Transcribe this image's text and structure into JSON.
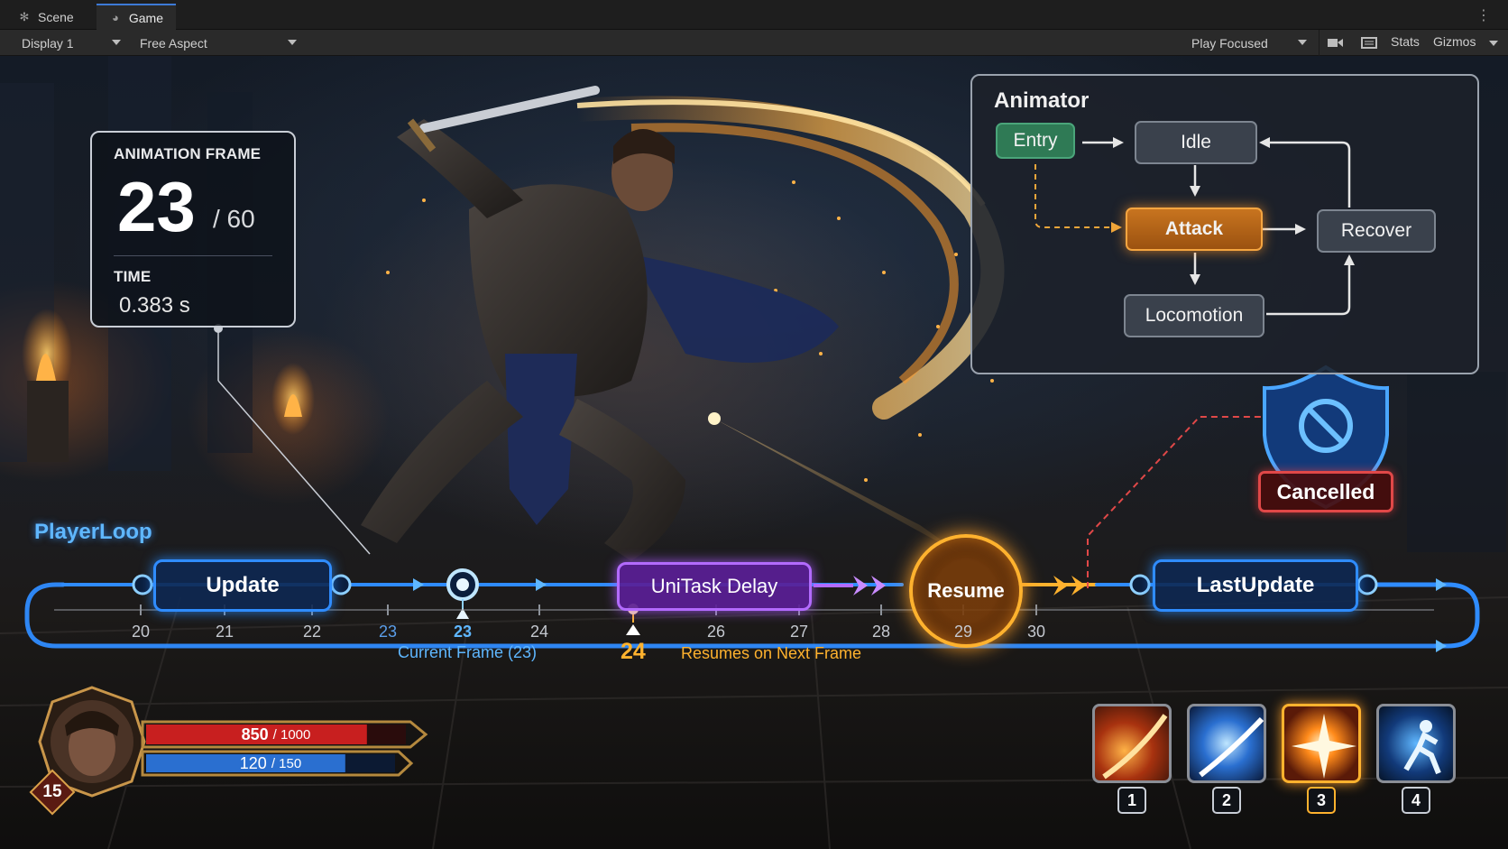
{
  "editor": {
    "tabs": [
      {
        "label": "Scene",
        "icon": "scene-icon"
      },
      {
        "label": "Game",
        "icon": "game-controller-icon"
      }
    ],
    "toolbar": {
      "display": "Display 1",
      "aspect": "Free Aspect",
      "play_mode": "Play Focused",
      "stats": "Stats",
      "gizmos": "Gizmos"
    }
  },
  "animation_frame": {
    "label": "ANIMATION FRAME",
    "frame": "23",
    "total": "/ 60",
    "time_label": "TIME",
    "time_value": "0.383 s"
  },
  "animator": {
    "title": "Animator",
    "states": {
      "entry": "Entry",
      "idle": "Idle",
      "attack": "Attack",
      "recover": "Recover",
      "locomotion": "Locomotion"
    }
  },
  "player_loop": {
    "title": "PlayerLoop",
    "update": "Update",
    "unitask_delay": "UniTask Delay",
    "resume": "Resume",
    "last_update": "LastUpdate",
    "ticks": [
      "20",
      "21",
      "22",
      "23",
      "23",
      "24",
      "26",
      "27",
      "28",
      "29",
      "30"
    ],
    "current_frame_note": "Current Frame (23)",
    "next_frame": "24",
    "next_frame_note": "Resumes on Next Frame"
  },
  "cancel": {
    "label": "Cancelled",
    "colors": {
      "shield": "#1e63c8",
      "badge_border": "#e04848"
    }
  },
  "hud": {
    "level": "15",
    "hp": {
      "value": "850",
      "max": "/ 1000",
      "fraction": 0.85
    },
    "mp": {
      "value": "120",
      "max": "/ 150",
      "fraction": 0.8
    },
    "skills": [
      {
        "key": "1",
        "icon": "fire-slash-icon",
        "active": false
      },
      {
        "key": "2",
        "icon": "ice-slash-icon",
        "active": false
      },
      {
        "key": "3",
        "icon": "burst-icon",
        "active": true
      },
      {
        "key": "4",
        "icon": "dash-icon",
        "active": false
      }
    ]
  },
  "colors": {
    "loop_blue": "#2f8cff",
    "resume_orange": "#ffb22e",
    "delay_purple": "#b36bff",
    "hp_red": "#c81f1f",
    "mp_blue": "#2a6fd0"
  }
}
